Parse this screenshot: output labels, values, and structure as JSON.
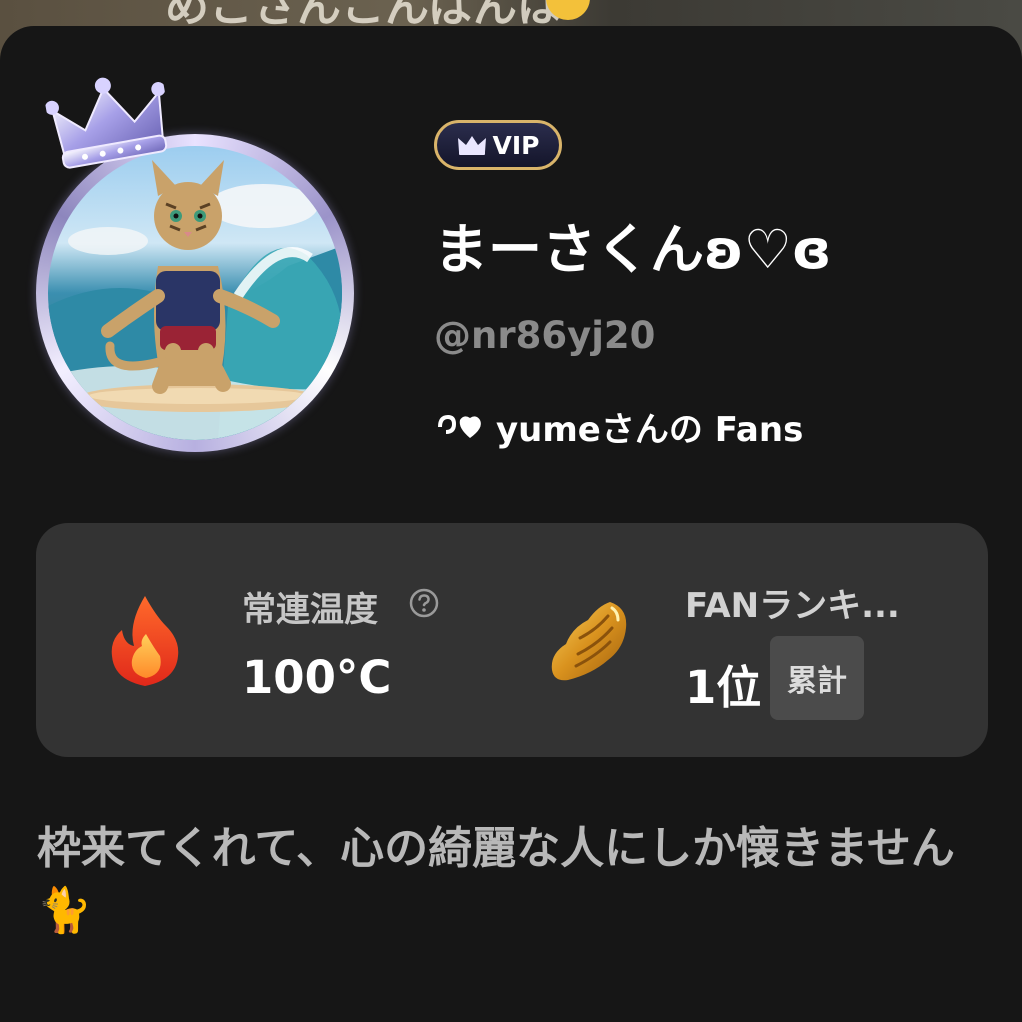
{
  "background": {
    "partial_text": "めこさんこんばんは"
  },
  "profile": {
    "badge_label": "VIP",
    "display_name": "まーさくんʚ♡ɞ",
    "handle": "@nr86yj20",
    "fan_of": "yumeさんの Fans"
  },
  "stats": {
    "temperature_title": "常連温度",
    "temperature_value": "100°C",
    "ranking_title": "FANランキ...",
    "ranking_value": "1位",
    "ranking_tag": "累計"
  },
  "bio": {
    "text": "枠来てくれて、心の綺麗な人にしか懐きません🐈"
  },
  "icons": {
    "crown": "crown-icon",
    "fire": "fire-icon",
    "wing": "golden-wing-icon",
    "help": "question-circle-icon"
  },
  "colors": {
    "sheet_bg": "#161616",
    "card_bg": "#333333",
    "vip_border": "#d9b46a",
    "handle_gray": "#8a8a8a"
  }
}
